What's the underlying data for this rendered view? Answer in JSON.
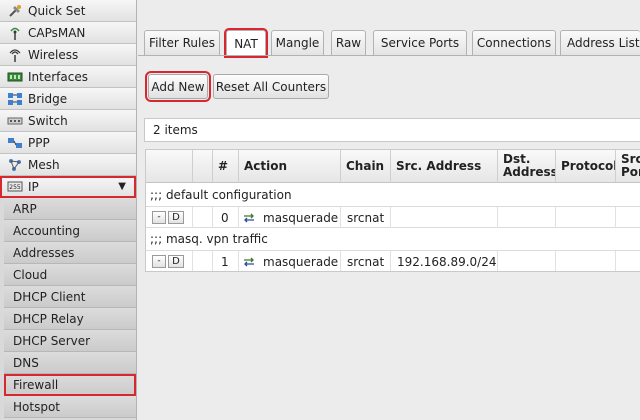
{
  "sidebar": {
    "items": [
      {
        "label": "Quick Set",
        "icon": "quick-set-icon"
      },
      {
        "label": "CAPsMAN",
        "icon": "capsman-icon"
      },
      {
        "label": "Wireless",
        "icon": "wireless-icon"
      },
      {
        "label": "Interfaces",
        "icon": "interfaces-icon"
      },
      {
        "label": "Bridge",
        "icon": "bridge-icon"
      },
      {
        "label": "Switch",
        "icon": "switch-icon"
      },
      {
        "label": "PPP",
        "icon": "ppp-icon"
      },
      {
        "label": "Mesh",
        "icon": "mesh-icon"
      },
      {
        "label": "IP",
        "icon": "ip-icon",
        "expanded": true
      }
    ],
    "ip_submenu": [
      "ARP",
      "Accounting",
      "Addresses",
      "Cloud",
      "DHCP Client",
      "DHCP Relay",
      "DHCP Server",
      "DNS",
      "Firewall",
      "Hotspot"
    ],
    "selected_submenu": "Firewall"
  },
  "tabs": [
    "Filter Rules",
    "NAT",
    "Mangle",
    "Raw",
    "Service Ports",
    "Connections",
    "Address Lists"
  ],
  "active_tab": "NAT",
  "toolbar": {
    "add_new_label": "Add New",
    "reset_counters_label": "Reset All Counters"
  },
  "item_count": "2 items",
  "table": {
    "columns": [
      "",
      "",
      "#",
      "Action",
      "Chain",
      "Src. Address",
      "Dst. Address",
      "Protocol",
      "Src. Port"
    ],
    "rows": [
      {
        "comment": ";;; default configuration",
        "remove_label": "-",
        "disable_label": "D",
        "number": "0",
        "action": "masquerade",
        "chain": "srcnat",
        "src_address": "",
        "dst_address": "",
        "protocol": ""
      },
      {
        "comment": ";;; masq. vpn traffic",
        "remove_label": "-",
        "disable_label": "D",
        "number": "1",
        "action": "masquerade",
        "chain": "srcnat",
        "src_address": "192.168.89.0/24",
        "dst_address": "",
        "protocol": ""
      }
    ]
  },
  "colors": {
    "highlight": "#d7282f",
    "sidebar_bg": "#d9d9d9",
    "page_bg": "#ececec"
  }
}
